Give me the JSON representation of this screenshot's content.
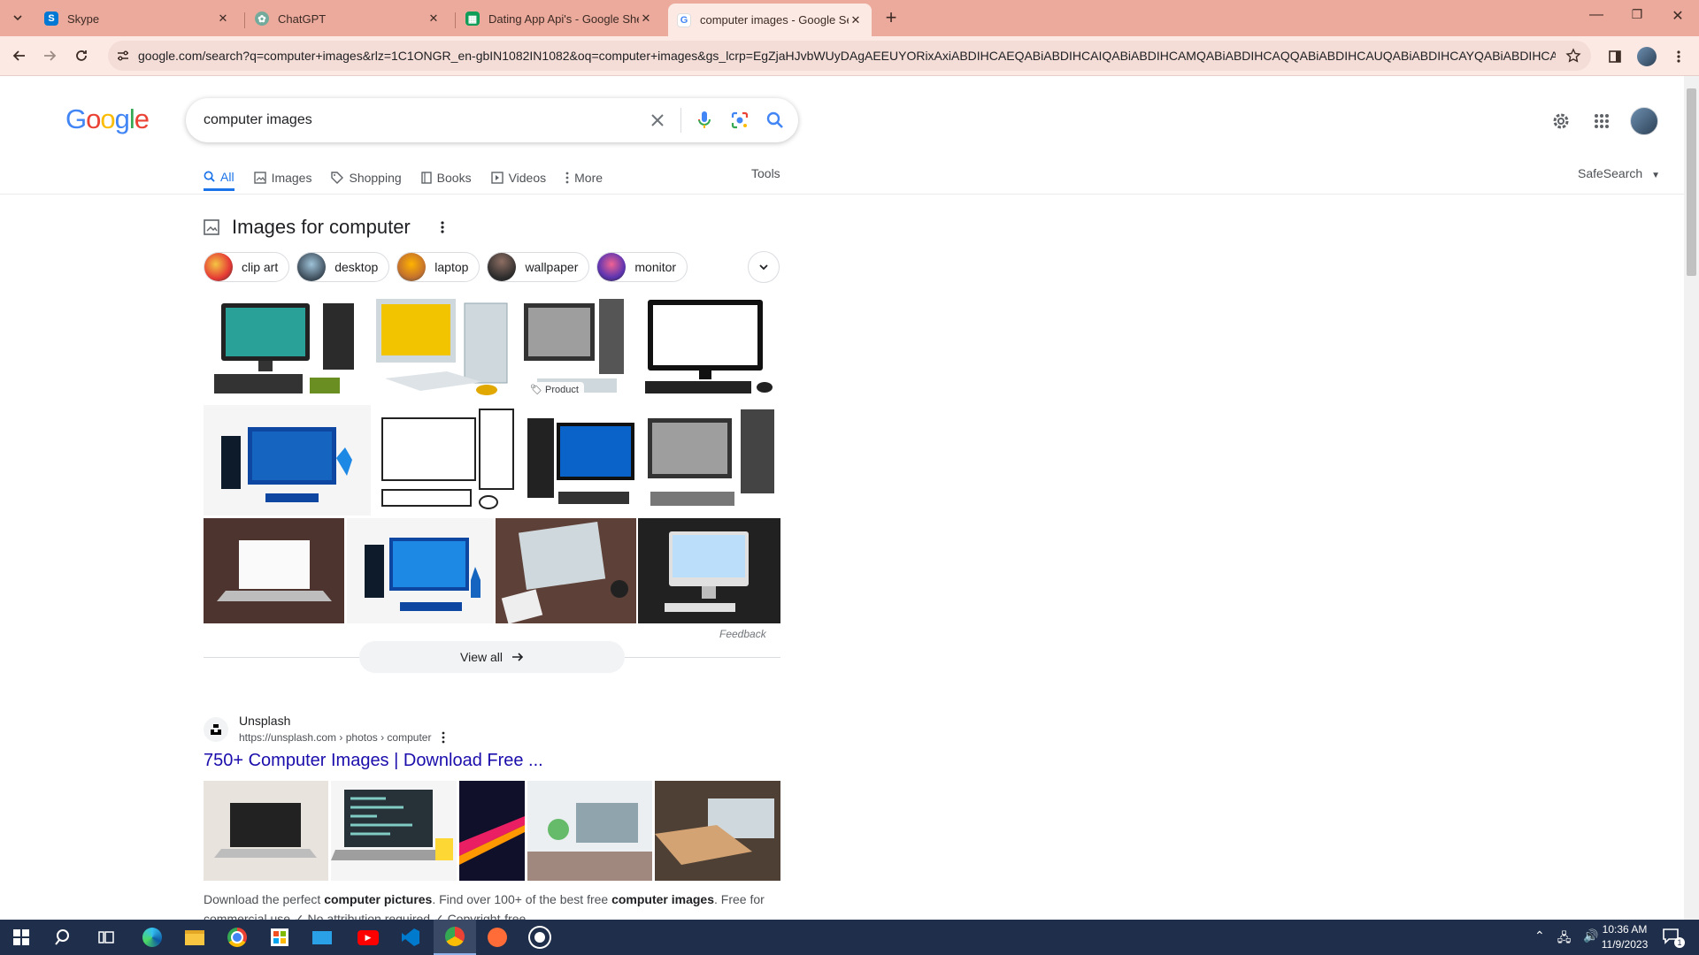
{
  "browser": {
    "tabs": [
      {
        "title": "Skype",
        "icon": "skype-icon",
        "color": "#0078d4"
      },
      {
        "title": "ChatGPT",
        "icon": "chatgpt-icon",
        "color": "#74aa9c"
      },
      {
        "title": "Dating App Api's - Google She",
        "icon": "sheets-icon",
        "color": "#0f9d58"
      },
      {
        "title": "computer images - Google Sea",
        "icon": "google-icon",
        "color": "#4285f4"
      }
    ],
    "active_tab": 3,
    "url": "google.com/search?q=computer+images&rlz=1C1ONGR_en-gbIN1082IN1082&oq=computer+images&gs_lcrp=EgZjaHJvbWUyDAgAEEUYORixAxiABDIHCAEQABiABDIHCAIQABiABDIHCAMQABiABDIHCAQQABiABDIHCAUQABiABDIHCAYQABiABDIHCACQABi..."
  },
  "google": {
    "logo": "Google",
    "logo_colors": [
      "#4285f4",
      "#ea4335",
      "#fbbc05",
      "#4285f4",
      "#34a853",
      "#ea4335"
    ],
    "query": "computer images",
    "nav_tabs": [
      {
        "label": "All",
        "icon": "search-icon"
      },
      {
        "label": "Images",
        "icon": "image-icon"
      },
      {
        "label": "Shopping",
        "icon": "tag-icon"
      },
      {
        "label": "Books",
        "icon": "book-icon"
      },
      {
        "label": "Videos",
        "icon": "play-icon"
      },
      {
        "label": "More",
        "icon": "more-vert-icon"
      }
    ],
    "tools": "Tools",
    "safesearch": "SafeSearch"
  },
  "images_section": {
    "title": "Images for computer",
    "chips": [
      "clip art",
      "desktop",
      "laptop",
      "wallpaper",
      "monitor"
    ],
    "product_badge": "Product",
    "feedback": "Feedback",
    "view_all": "View all"
  },
  "result": {
    "site": "Unsplash",
    "url_base": "https://unsplash.com",
    "url_path": "› photos › computer",
    "title": "750+ Computer Images | Download Free ...",
    "snippet_1": "Download the perfect ",
    "snippet_b1": "computer pictures",
    "snippet_2": ". Find over 100+ of the best free ",
    "snippet_b2": "computer images",
    "snippet_3": ". Free for commercial use ✓ No attribution required ✓ Copyright-free"
  },
  "taskbar": {
    "time": "10:36 AM",
    "date": "11/9/2023",
    "notification_count": "1"
  }
}
